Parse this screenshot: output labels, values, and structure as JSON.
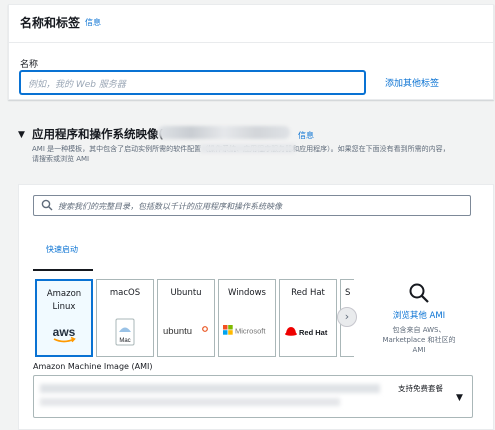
{
  "name_tags": {
    "title": "名称和标签",
    "info_link": "信息",
    "name_label": "名称",
    "name_placeholder": "例如，我的 Web 服务器",
    "add_tags_link": "添加其他标签"
  },
  "ami_section": {
    "title": "应用程序和操作系统映像(",
    "info_link": "信息",
    "description_line1": "AMI 是一种模板，其中包含了启动实例所需的软件配置（操作系统、应用程序服务器和应用程序）。如果您在下面没有看到所需的内容，",
    "description_line2": "请搜索或浏览 AMI",
    "search_placeholder": "搜索我们的完整目录，包括数以千计的应用程序和操作系统映像",
    "tab_label": "快速启动",
    "os_cards": [
      {
        "name": "Amazon\nLinux",
        "logo": "aws-logo",
        "selected": true
      },
      {
        "name": "macOS",
        "logo": "mac-logo",
        "selected": false
      },
      {
        "name": "Ubuntu",
        "logo": "ubuntu-logo",
        "selected": false
      },
      {
        "name": "Windows",
        "logo": "microsoft-logo",
        "selected": false
      },
      {
        "name": "Red Hat",
        "logo": "redhat-logo",
        "selected": false
      },
      {
        "name": "S",
        "logo": "",
        "selected": false
      }
    ],
    "logo_text": {
      "aws": "aws",
      "mac": "Mac",
      "ubuntu": "ubuntu",
      "microsoft": "Microsoft",
      "redhat": "Red Hat"
    },
    "browse_more_link": "浏览其他 AMI",
    "browse_more_desc": "包含来自 AWS、\nMarketplace 和社区的\nAMI",
    "ami_label": "Amazon Machine Image (AMI)",
    "free_tier_badge": "支持免费套餐"
  },
  "colors": {
    "link": "#0972d3",
    "selected_border": "#0972d3",
    "aws_orange": "#ff9900",
    "ubuntu_orange": "#e95420",
    "redhat_red": "#ee0000"
  }
}
